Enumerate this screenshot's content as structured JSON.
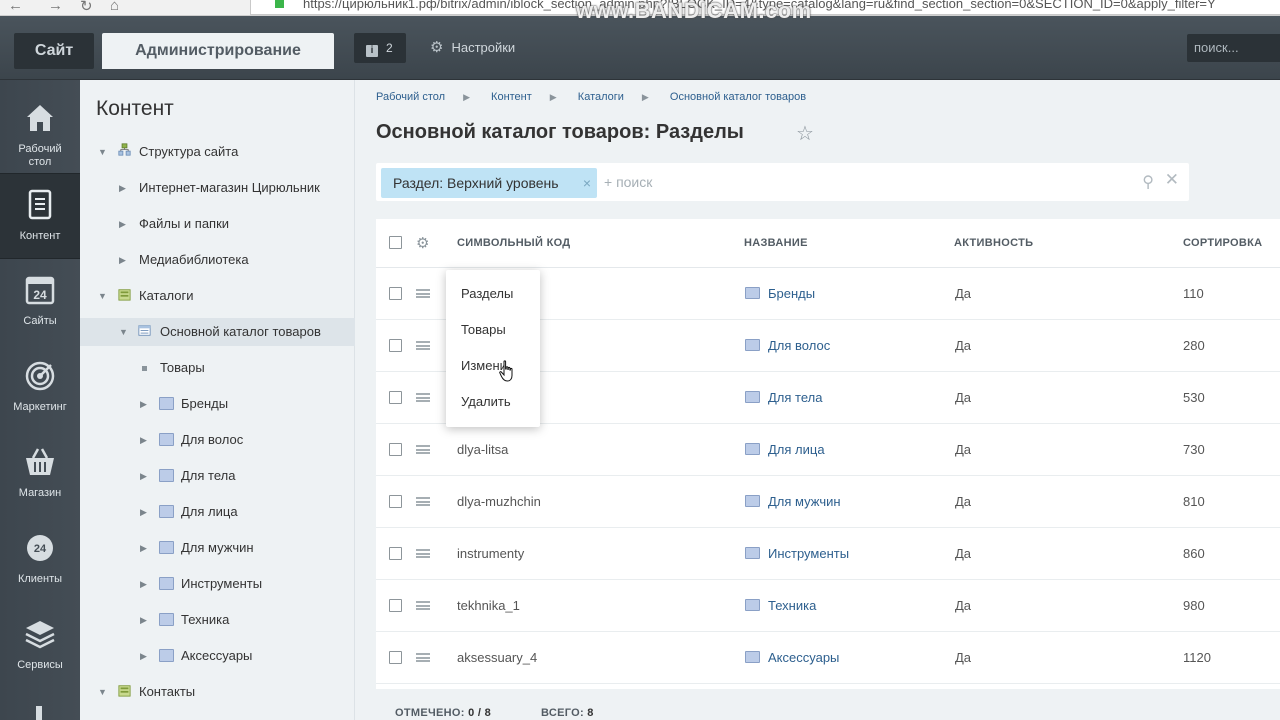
{
  "browser": {
    "url": "https://цирюльник1.рф/bitrix/admin/iblock_section_admin.php?IBLOCK_ID=4&type=catalog&lang=ru&find_section_section=0&SECTION_ID=0&apply_filter=Y",
    "watermark": "www.BANDICAM.com"
  },
  "topbar": {
    "site_label": "Сайт",
    "admin_label": "Администрирование",
    "notifications_count": "2",
    "settings_label": "Настройки",
    "search_placeholder": "поиск..."
  },
  "leftmenu": [
    {
      "label": "Рабочий стол",
      "icon": "home-icon"
    },
    {
      "label": "Контент",
      "icon": "content-icon"
    },
    {
      "label": "Сайты",
      "icon": "calendar-24-icon"
    },
    {
      "label": "Маркетинг",
      "icon": "target-icon"
    },
    {
      "label": "Магазин",
      "icon": "basket-icon"
    },
    {
      "label": "Клиенты",
      "icon": "clock-24-icon"
    },
    {
      "label": "Сервисы",
      "icon": "layers-icon"
    }
  ],
  "tree": {
    "title": "Контент",
    "items": [
      {
        "label": "Структура сайта"
      },
      {
        "label": "Интернет-магазин Цирюльник"
      },
      {
        "label": "Файлы и папки"
      },
      {
        "label": "Медиабиблиотека"
      },
      {
        "label": "Каталоги"
      },
      {
        "label": "Основной каталог товаров"
      },
      {
        "label": "Товары"
      },
      {
        "label": "Бренды"
      },
      {
        "label": "Для волос"
      },
      {
        "label": "Для тела"
      },
      {
        "label": "Для лица"
      },
      {
        "label": "Для мужчин"
      },
      {
        "label": "Инструменты"
      },
      {
        "label": "Техника"
      },
      {
        "label": "Аксессуары"
      },
      {
        "label": "Контакты"
      }
    ]
  },
  "breadcrumb": [
    "Рабочий стол",
    "Контент",
    "Каталоги",
    "Основной каталог товаров"
  ],
  "page_title": "Основной каталог товаров: Разделы",
  "filter": {
    "chip_label": "Раздел: Верхний уровень",
    "placeholder": "+ поиск"
  },
  "grid": {
    "columns": [
      "СИМВОЛЬНЫЙ КОД",
      "НАЗВАНИЕ",
      "АКТИВНОСТЬ",
      "СОРТИРОВКА"
    ],
    "rows": [
      {
        "code": "",
        "name": "Бренды",
        "active": "Да",
        "sort": "110"
      },
      {
        "code": "",
        "name": "Для волос",
        "active": "Да",
        "sort": "280"
      },
      {
        "code": "",
        "name": "Для тела",
        "active": "Да",
        "sort": "530"
      },
      {
        "code": "dlya-litsa",
        "name": "Для лица",
        "active": "Да",
        "sort": "730"
      },
      {
        "code": "dlya-muzhchin",
        "name": "Для мужчин",
        "active": "Да",
        "sort": "810"
      },
      {
        "code": "instrumenty",
        "name": "Инструменты",
        "active": "Да",
        "sort": "860"
      },
      {
        "code": "tekhnika_1",
        "name": "Техника",
        "active": "Да",
        "sort": "980"
      },
      {
        "code": "aksessuary_4",
        "name": "Аксессуары",
        "active": "Да",
        "sort": "1120"
      }
    ],
    "footer_selected_label": "ОТМЕЧЕНО:",
    "footer_selected_value": "0 / 8",
    "footer_total_label": "ВСЕГО:",
    "footer_total_value": "8"
  },
  "context_menu": {
    "items": [
      "Разделы",
      "Товары",
      "Изменить",
      "Удалить"
    ],
    "shown_labels": [
      "Разделы",
      "Товары",
      "Измени",
      "Удалить"
    ]
  }
}
